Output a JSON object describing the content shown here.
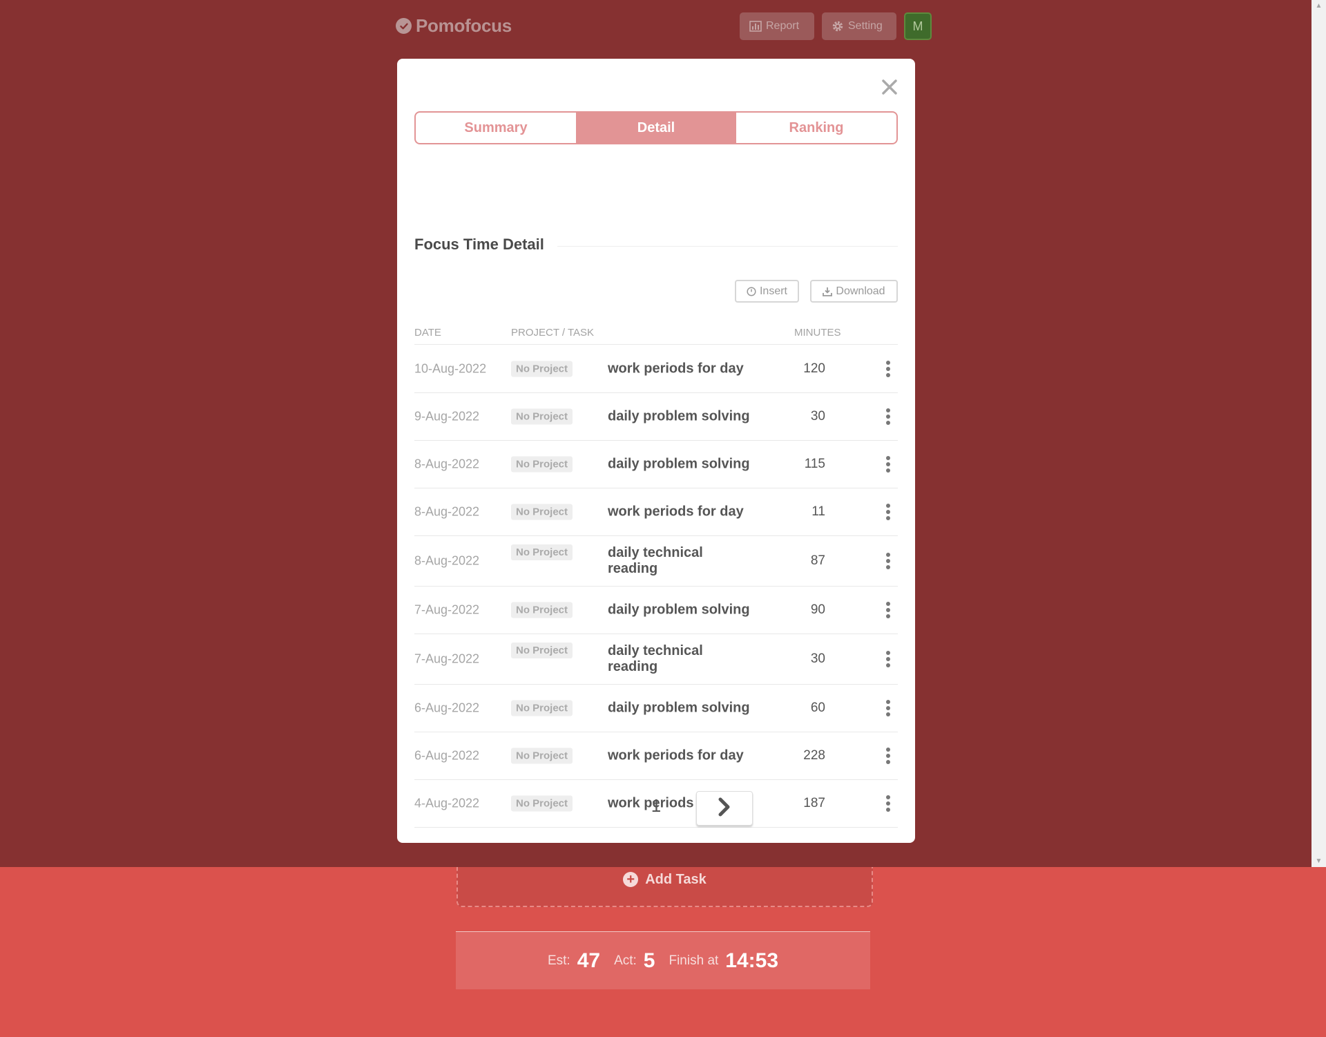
{
  "app": {
    "name": "Pomofocus",
    "report_label": "Report",
    "setting_label": "Setting",
    "avatar_letter": "M"
  },
  "report": {
    "tabs": [
      {
        "label": "Summary",
        "active": false
      },
      {
        "label": "Detail",
        "active": true
      },
      {
        "label": "Ranking",
        "active": false
      }
    ],
    "section_title": "Focus Time Detail",
    "insert_label": "Insert",
    "download_label": "Download",
    "columns": {
      "date": "DATE",
      "project_task": "PROJECT / TASK",
      "minutes": "MINUTES"
    },
    "rows": [
      {
        "date": "10-Aug-2022",
        "project": "No Project",
        "task": "work periods for day",
        "minutes": "120"
      },
      {
        "date": "9-Aug-2022",
        "project": "No Project",
        "task": "daily problem solving",
        "minutes": "30"
      },
      {
        "date": "8-Aug-2022",
        "project": "No Project",
        "task": "daily problem solving",
        "minutes": "115"
      },
      {
        "date": "8-Aug-2022",
        "project": "No Project",
        "task": "work periods for day",
        "minutes": "11"
      },
      {
        "date": "8-Aug-2022",
        "project": "No Project",
        "task": "daily technical reading",
        "minutes": "87"
      },
      {
        "date": "7-Aug-2022",
        "project": "No Project",
        "task": "daily problem solving",
        "minutes": "90"
      },
      {
        "date": "7-Aug-2022",
        "project": "No Project",
        "task": "daily technical reading",
        "minutes": "30"
      },
      {
        "date": "6-Aug-2022",
        "project": "No Project",
        "task": "daily problem solving",
        "minutes": "60"
      },
      {
        "date": "6-Aug-2022",
        "project": "No Project",
        "task": "work periods for day",
        "minutes": "228"
      },
      {
        "date": "4-Aug-2022",
        "project": "No Project",
        "task": "work periods for day",
        "minutes": "187"
      }
    ],
    "current_page": "1"
  },
  "tasks": {
    "add_task_label": "Add Task"
  },
  "summary": {
    "est_label": "Est:",
    "est_value": "47",
    "act_label": "Act:",
    "act_value": "5",
    "finish_label": "Finish at",
    "finish_value": "14:53"
  },
  "colors": {
    "page_bg": "#db524d",
    "backdrop": "#863131",
    "accent": "#e29495",
    "avatar": "#3f6b2b"
  },
  "icons": {
    "logo": "check-circle-icon",
    "report": "bar-chart-icon",
    "setting": "gear-icon",
    "close": "close-icon",
    "insert": "clock-icon",
    "download": "download-icon",
    "row_menu": "kebab-menu-icon",
    "next_page": "chevron-right-icon",
    "add_task": "plus-circle-icon"
  }
}
